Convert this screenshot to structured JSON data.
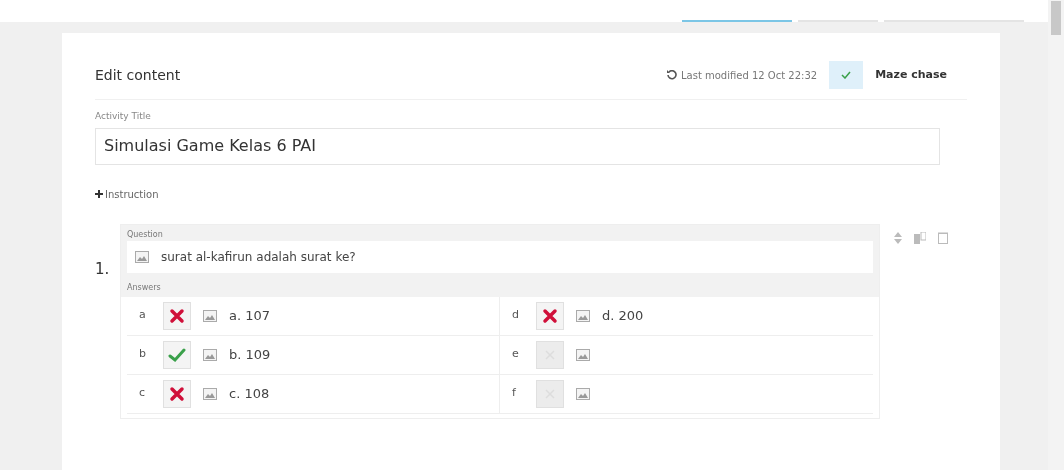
{
  "top_tabs": [
    {
      "selected": true
    },
    {
      "selected": false
    },
    {
      "selected": false
    }
  ],
  "header": {
    "title": "Edit content",
    "last_modified": "Last modified 12 Oct 22:32",
    "template": "Maze chase"
  },
  "activity_title": {
    "label": "Activity Title",
    "value": "Simulasi Game Kelas 6 PAI"
  },
  "instruction_link": "Instruction",
  "questions": [
    {
      "number": "1.",
      "label": "Question",
      "text": "surat al-kafirun adalah surat ke?",
      "answers_label": "Answers",
      "answers": [
        {
          "letter": "a",
          "kind": "wrong",
          "text": "a. 107"
        },
        {
          "letter": "b",
          "kind": "correct",
          "text": "b. 109"
        },
        {
          "letter": "c",
          "kind": "wrong",
          "text": "c. 108"
        },
        {
          "letter": "d",
          "kind": "wrong",
          "text": "d. 200"
        },
        {
          "letter": "e",
          "kind": "blank"
        },
        {
          "letter": "f",
          "kind": "blank"
        }
      ]
    }
  ]
}
